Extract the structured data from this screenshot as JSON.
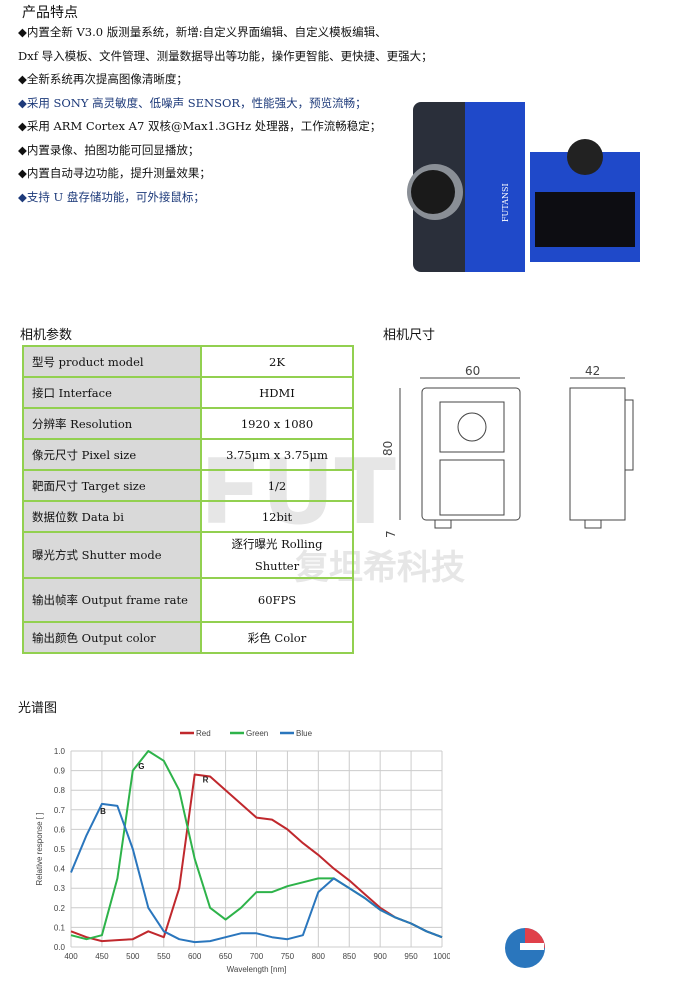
{
  "features": {
    "title": "产品特点",
    "items": [
      "◆内置全新 V3.0 版测量系统，新增:自定义界面编辑、自定义模板编辑、",
      "Dxf 导入模板、文件管理、测量数据导出等功能，操作更智能、更快捷、更强大；",
      "◆全新系统再次提高图像清晰度；",
      "◆采用 SONY 高灵敏度、低噪声 SENSOR，性能强大，预览流畅；",
      "◆采用 ARM Cortex A7 双核@Max1.3GHz 处理器，工作流畅稳定；",
      "◆内置录像、拍图功能可回显播放；",
      "◆内置自动寻边功能，提升测量效果；",
      "◆支持 U 盘存储功能，可外接鼠标；"
    ]
  },
  "camera_image": {
    "brand": "FUTANSI"
  },
  "params": {
    "title": "相机参数",
    "rows": [
      {
        "k": "型号 product model",
        "v": "2K"
      },
      {
        "k": "接口 Interface",
        "v": "HDMI"
      },
      {
        "k": "分辨率 Resolution",
        "v": "1920 x 1080"
      },
      {
        "k": "像元尺寸 Pixel size",
        "v": "3.75μm x 3.75μm"
      },
      {
        "k": "靶面尺寸 Target size",
        "v": "1/2"
      },
      {
        "k": "数据位数 Data bi",
        "v": "12bit"
      },
      {
        "k": "曝光方式 Shutter mode",
        "v": "逐行曝光 Rolling Shutter"
      },
      {
        "k": "输出帧率 Output frame rate",
        "v": "60FPS"
      },
      {
        "k": "输出颜色 Output color",
        "v": "彩色 Color"
      }
    ]
  },
  "dims": {
    "title": "相机尺寸",
    "width": "60",
    "depth": "42",
    "height": "80",
    "foot": "7"
  },
  "watermark": {
    "text": "FUT",
    "cn": "复坦希科技"
  },
  "spectrum": {
    "title": "光谱图"
  },
  "chart_data": {
    "type": "line",
    "title": "",
    "xlabel": "Wavelength [nm]",
    "ylabel": "Relative response [ ]",
    "xlim": [
      400,
      1000
    ],
    "ylim": [
      0,
      1.0
    ],
    "grid": true,
    "legend": "top",
    "xticks": [
      400,
      450,
      500,
      550,
      600,
      650,
      700,
      750,
      800,
      850,
      900,
      950,
      1000
    ],
    "yticks": [
      "0.0",
      "0.1",
      "0.2",
      "0.3",
      "0.4",
      "0.5",
      "0.6",
      "0.7",
      "0.8",
      "0.9",
      "1.0"
    ],
    "x": [
      400,
      425,
      450,
      475,
      500,
      525,
      550,
      575,
      600,
      625,
      650,
      675,
      700,
      725,
      750,
      775,
      800,
      825,
      850,
      875,
      900,
      925,
      950,
      975,
      1000
    ],
    "series": [
      {
        "name": "Red",
        "color": "#c0282d",
        "label": "R",
        "values": [
          0.08,
          0.05,
          0.03,
          0.035,
          0.04,
          0.08,
          0.05,
          0.3,
          0.88,
          0.87,
          0.8,
          0.73,
          0.66,
          0.65,
          0.6,
          0.53,
          0.47,
          0.4,
          0.34,
          0.27,
          0.2,
          0.15,
          0.12,
          0.08,
          0.05
        ]
      },
      {
        "name": "Green",
        "color": "#2eb34a",
        "label": "G",
        "values": [
          0.06,
          0.04,
          0.06,
          0.35,
          0.9,
          1.0,
          0.95,
          0.8,
          0.45,
          0.2,
          0.14,
          0.2,
          0.28,
          0.28,
          0.31,
          0.33,
          0.35,
          0.35,
          0.3,
          0.25,
          0.19,
          0.15,
          0.12,
          0.08,
          0.05
        ]
      },
      {
        "name": "Blue",
        "color": "#2a76bd",
        "label": "B",
        "values": [
          0.38,
          0.57,
          0.73,
          0.72,
          0.5,
          0.2,
          0.08,
          0.04,
          0.025,
          0.03,
          0.05,
          0.07,
          0.07,
          0.05,
          0.04,
          0.06,
          0.28,
          0.35,
          0.3,
          0.25,
          0.19,
          0.15,
          0.12,
          0.08,
          0.05
        ]
      }
    ]
  }
}
